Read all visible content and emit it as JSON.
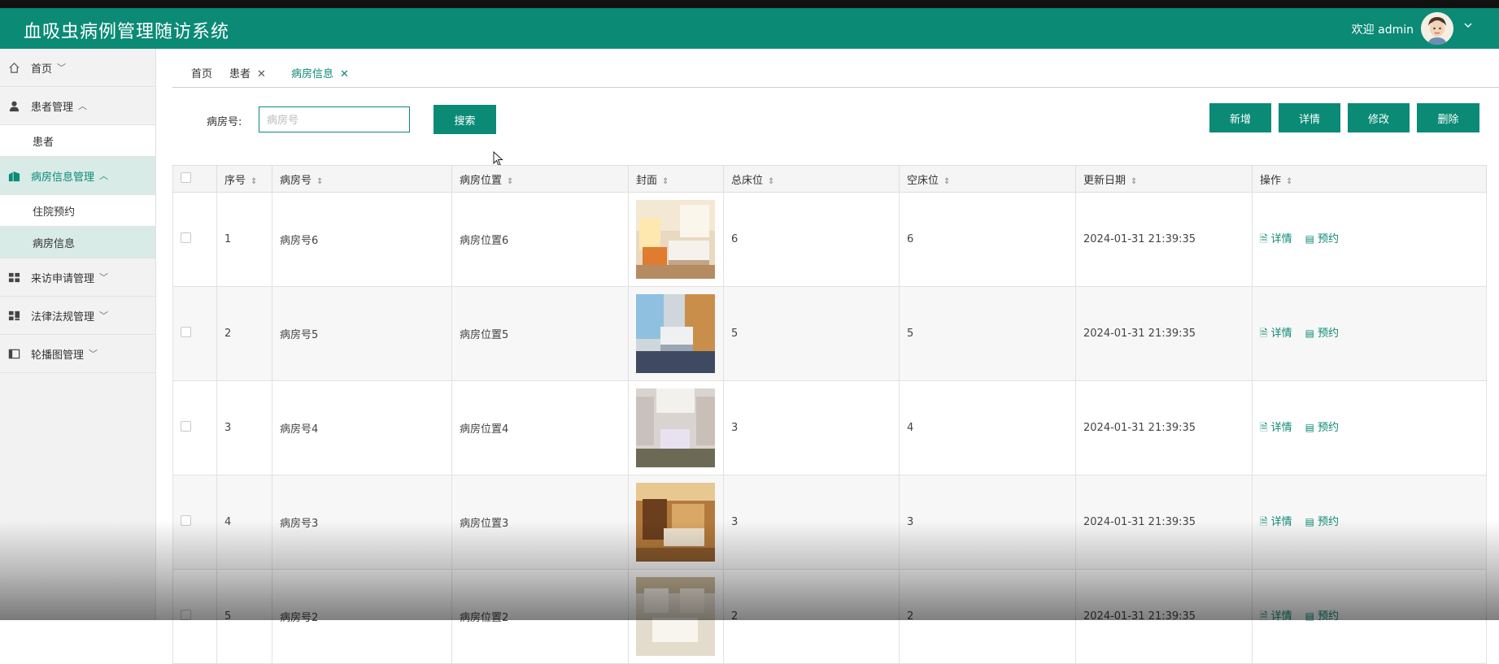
{
  "header": {
    "title": "血吸虫病例管理随访系统",
    "welcome": "欢迎 admin"
  },
  "sidebar": {
    "items": [
      {
        "label": "首页",
        "icon": "home-icon"
      },
      {
        "label": "患者管理",
        "icon": "user-icon",
        "expanded": true,
        "children": [
          {
            "label": "患者"
          }
        ]
      },
      {
        "label": "病房信息管理",
        "icon": "ward-icon",
        "expanded": true,
        "children": [
          {
            "label": "住院预约"
          },
          {
            "label": "病房信息"
          }
        ]
      },
      {
        "label": "来访申请管理",
        "icon": "grid-icon"
      },
      {
        "label": "法律法规管理",
        "icon": "grid2-icon"
      },
      {
        "label": "轮播图管理",
        "icon": "panel-icon"
      }
    ]
  },
  "tabs": [
    {
      "label": "首页"
    },
    {
      "label": "患者"
    },
    {
      "label": "病房信息"
    }
  ],
  "search": {
    "label": "病房号:",
    "placeholder": "病房号",
    "button": "搜索"
  },
  "toolbar": {
    "add": "新增",
    "detail": "详情",
    "edit": "修改",
    "delete": "删除"
  },
  "colors": {
    "primary": "#0b8a76"
  },
  "table": {
    "columns": [
      "序号",
      "病房号",
      "病房位置",
      "封面",
      "总床位",
      "空床位",
      "更新日期",
      "操作"
    ],
    "actions": [
      "详情",
      "预约"
    ],
    "rows": [
      {
        "no": "1",
        "room": "病房号6",
        "location": "病房位置6",
        "total": "6",
        "free": "6",
        "date": "2024-01-31 21:39:35"
      },
      {
        "no": "2",
        "room": "病房号5",
        "location": "病房位置5",
        "total": "5",
        "free": "5",
        "date": "2024-01-31 21:39:35"
      },
      {
        "no": "3",
        "room": "病房号4",
        "location": "病房位置4",
        "total": "3",
        "free": "4",
        "date": "2024-01-31 21:39:35"
      },
      {
        "no": "4",
        "room": "病房号3",
        "location": "病房位置3",
        "total": "3",
        "free": "3",
        "date": "2024-01-31 21:39:35"
      },
      {
        "no": "5",
        "room": "病房号2",
        "location": "病房位置2",
        "total": "2",
        "free": "2",
        "date": "2024-01-31 21:39:35"
      }
    ]
  }
}
